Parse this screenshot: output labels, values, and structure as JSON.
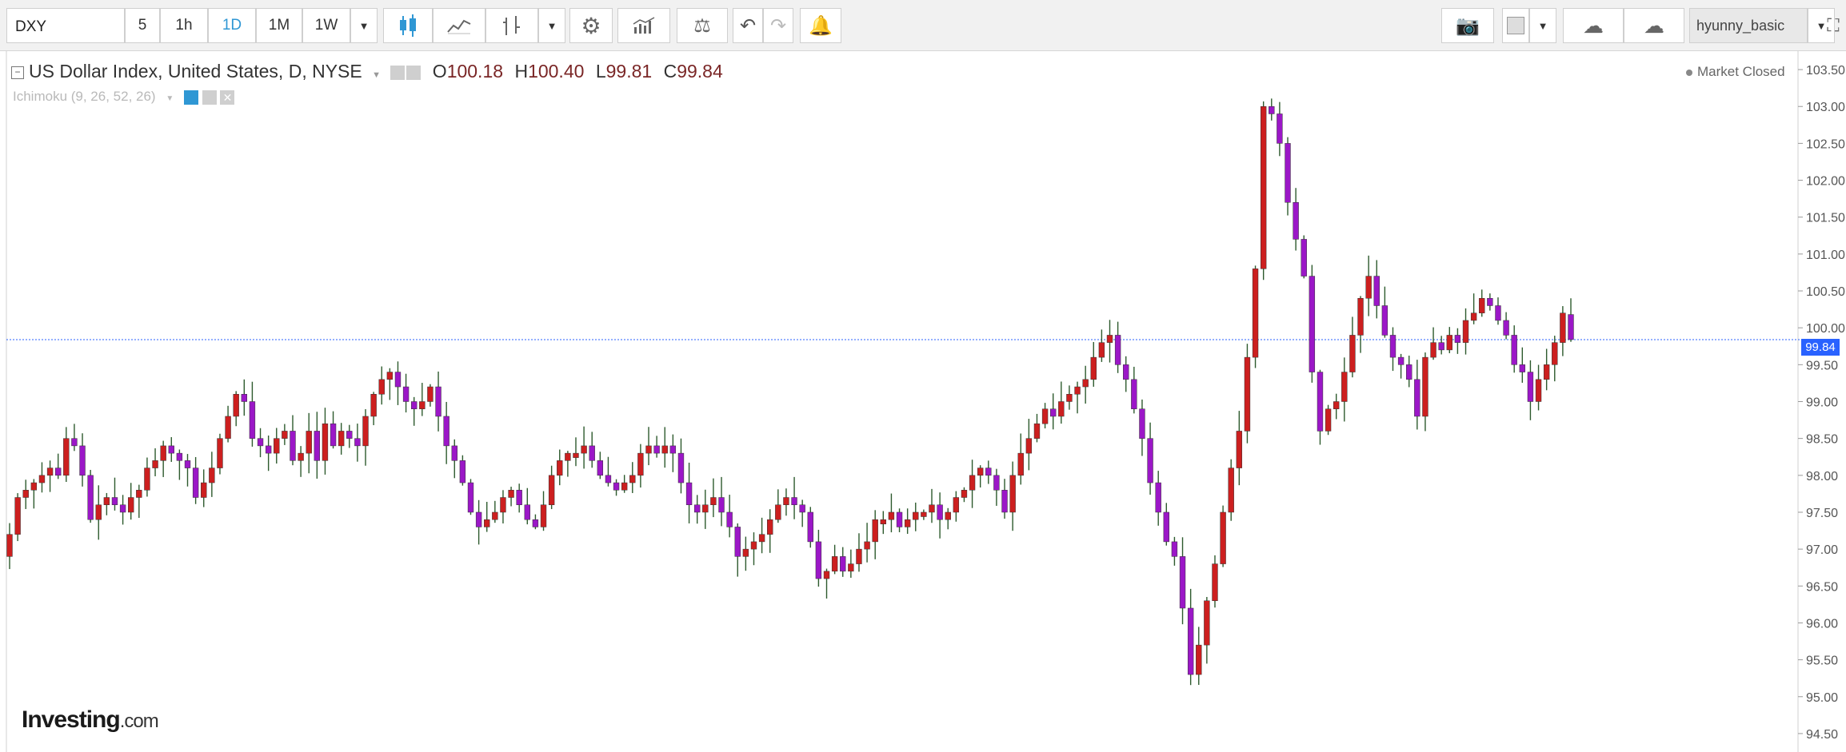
{
  "toolbar": {
    "symbol": "DXY",
    "intervals": [
      "5",
      "1h",
      "1D",
      "1M",
      "1W"
    ],
    "active_interval": "1D",
    "user": "hyunny_basic"
  },
  "legend": {
    "title": "US Dollar Index, United States, D, NYSE",
    "o_label": "O",
    "o_value": "100.18",
    "h_label": "H",
    "h_value": "100.40",
    "l_label": "L",
    "l_value": "99.81",
    "c_label": "C",
    "c_value": "99.84",
    "indicator": "Ichimoku (9, 26, 52, 26)"
  },
  "status": "Market Closed",
  "logo": {
    "main": "Investing",
    "suffix": ".com"
  },
  "current_price_label": "99.84",
  "colors": {
    "up_candle": "#cc1f1f",
    "down_candle": "#9b17c7",
    "wick": "#2d5a2d",
    "price_line": "#2962ff",
    "active": "#2f97d4"
  },
  "chart_data": {
    "type": "candlestick",
    "ylim": [
      94.25,
      103.75
    ],
    "yticks": [
      "94.50",
      "95.00",
      "95.50",
      "96.00",
      "96.50",
      "97.00",
      "97.50",
      "98.00",
      "98.50",
      "99.00",
      "99.50",
      "100.00",
      "100.50",
      "101.00",
      "101.50",
      "102.00",
      "102.50",
      "103.00",
      "103.50"
    ],
    "current_price": 99.84,
    "last_candle": {
      "open": 100.18,
      "high": 100.4,
      "low": 99.81,
      "close": 99.84
    },
    "closes": [
      97.2,
      97.7,
      97.8,
      97.9,
      98.0,
      98.1,
      98.0,
      98.5,
      98.4,
      98.0,
      97.4,
      97.6,
      97.7,
      97.6,
      97.5,
      97.7,
      97.8,
      98.1,
      98.2,
      98.4,
      98.3,
      98.2,
      98.1,
      97.7,
      97.9,
      98.1,
      98.5,
      98.8,
      99.1,
      99.0,
      98.5,
      98.4,
      98.3,
      98.5,
      98.6,
      98.2,
      98.3,
      98.6,
      98.2,
      98.7,
      98.4,
      98.6,
      98.5,
      98.4,
      98.8,
      99.1,
      99.3,
      99.4,
      99.2,
      99.0,
      98.9,
      99.0,
      99.2,
      98.8,
      98.4,
      98.2,
      97.9,
      97.5,
      97.3,
      97.4,
      97.5,
      97.7,
      97.8,
      97.6,
      97.4,
      97.3,
      97.6,
      98.0,
      98.2,
      98.3,
      98.3,
      98.4,
      98.2,
      98.0,
      97.9,
      97.8,
      97.9,
      98.0,
      98.3,
      98.4,
      98.3,
      98.4,
      98.3,
      97.9,
      97.6,
      97.5,
      97.6,
      97.7,
      97.5,
      97.3,
      96.9,
      97.0,
      97.1,
      97.2,
      97.4,
      97.6,
      97.7,
      97.6,
      97.5,
      97.1,
      96.6,
      96.7,
      96.9,
      96.7,
      96.8,
      97.0,
      97.1,
      97.4,
      97.4,
      97.5,
      97.3,
      97.4,
      97.5,
      97.5,
      97.6,
      97.4,
      97.5,
      97.7,
      97.8,
      98.0,
      98.1,
      98.0,
      97.8,
      97.5,
      98.0,
      98.3,
      98.5,
      98.7,
      98.9,
      98.8,
      99.0,
      99.1,
      99.2,
      99.3,
      99.6,
      99.8,
      99.9,
      99.5,
      99.3,
      98.9,
      98.5,
      97.9,
      97.5,
      97.1,
      96.9,
      96.2,
      95.3,
      95.7,
      96.3,
      96.8,
      97.5,
      98.1,
      98.6,
      99.6,
      100.8,
      103.0,
      102.9,
      102.5,
      101.7,
      101.2,
      100.7,
      99.4,
      98.6,
      98.9,
      99.0,
      99.4,
      99.9,
      100.4,
      100.7,
      100.3,
      99.9,
      99.6,
      99.5,
      99.3,
      98.8,
      99.6,
      99.8,
      99.7,
      99.9,
      99.8,
      100.1,
      100.2,
      100.4,
      100.3,
      100.1,
      99.9,
      99.5,
      99.4,
      99.0,
      99.3,
      99.5,
      99.8,
      100.2,
      99.84
    ]
  }
}
